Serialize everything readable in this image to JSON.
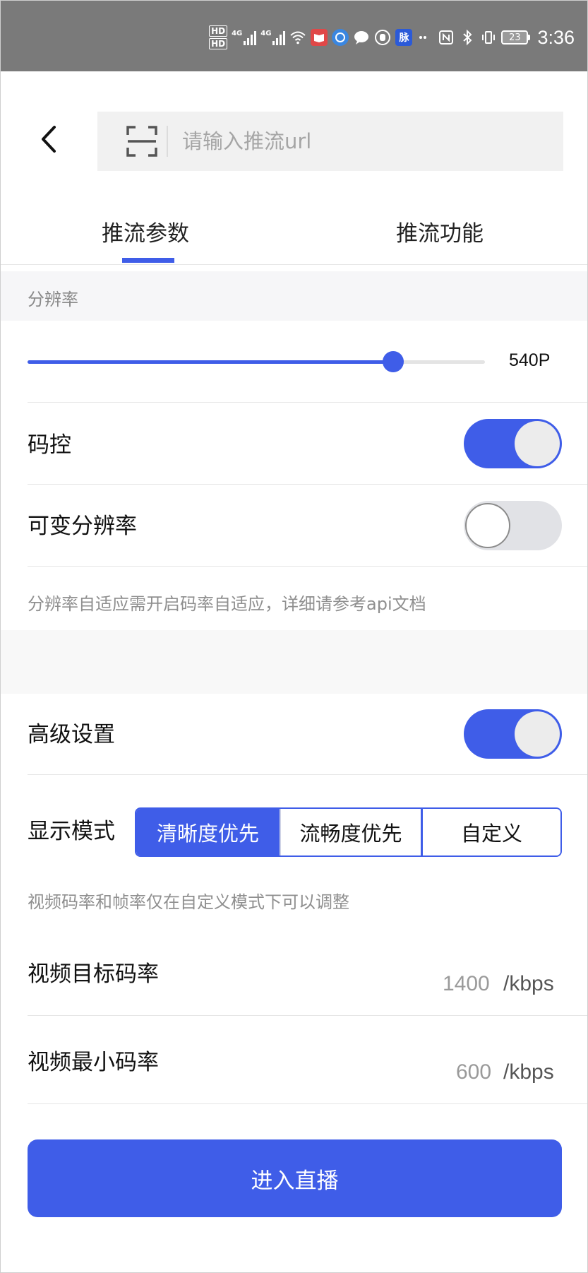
{
  "status_bar": {
    "hd1": "HD",
    "hd2": "HD",
    "net1": "4G",
    "net2": "4G",
    "chip_label": "脉",
    "battery": "23",
    "time": "3:36"
  },
  "header": {
    "search_placeholder": "请输入推流url"
  },
  "tabs": [
    {
      "label": "推流参数"
    },
    {
      "label": "推流功能"
    }
  ],
  "resolution": {
    "section_title": "分辨率",
    "slider_fraction": 0.8,
    "value_label": "540P"
  },
  "rate_control": {
    "label": "码控",
    "enabled": true
  },
  "variable_resolution": {
    "label": "可变分辨率",
    "enabled": false
  },
  "resolution_note": "分辨率自适应需开启码率自适应，详细请参考api文档",
  "advanced": {
    "label": "高级设置",
    "enabled": true
  },
  "display_mode": {
    "label": "显示模式",
    "options": [
      "清晰度优先",
      "流畅度优先",
      "自定义"
    ],
    "selected": "清晰度优先"
  },
  "rate_note": "视频码率和帧率仅在自定义模式下可以调整",
  "target_bitrate": {
    "label": "视频目标码率",
    "value": "1400",
    "unit": "/kbps"
  },
  "min_bitrate": {
    "label": "视频最小码率",
    "value": "600",
    "unit": "/kbps"
  },
  "cta_label": "进入直播",
  "colors": {
    "accent": "#3f5de8",
    "status_bar": "#7a7a7a"
  }
}
